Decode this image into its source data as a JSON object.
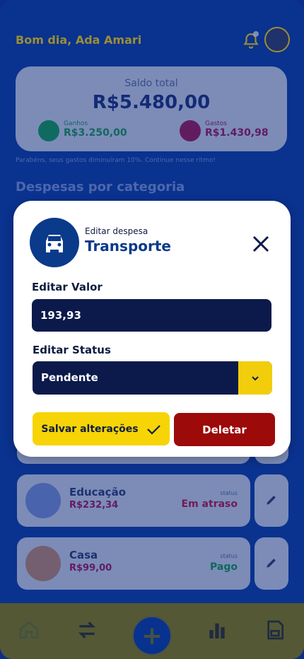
{
  "header": {
    "greeting": "Bom dia, Ada Amari"
  },
  "balance": {
    "label": "Saldo total",
    "value": "R$5.480,00",
    "income_label": "Ganhos",
    "income_value": "R$3.250,00",
    "expense_label": "Gastos",
    "expense_value": "R$1.430,98"
  },
  "tip": "Parabéns, seus gastos diminuíram 10%. Continue nesse ritmo!",
  "section_title": "Despesas por categoria",
  "categories": [
    {
      "name": "Educação",
      "amount": "R$232,34",
      "status_label": "status",
      "status": "Em atraso",
      "status_color": "#c2133f"
    },
    {
      "name": "Casa",
      "amount": "R$99,00",
      "status_label": "status",
      "status": "Pago",
      "status_color": "#169a49"
    }
  ],
  "modal": {
    "subtitle": "Editar despesa",
    "title": "Transporte",
    "value_label": "Editar Valor",
    "value": "193,93",
    "status_label": "Editar Status",
    "status_value": "Pendente",
    "save_label": "Salvar alterações",
    "delete_label": "Deletar"
  },
  "colors": {
    "primary": "#0a3a8a",
    "accent": "#f6d405",
    "danger": "#9c0a0a",
    "dark": "#0b1a4a"
  },
  "icons": [
    "bell-icon",
    "avatar",
    "car-icon",
    "close-icon",
    "chevron-down-icon",
    "check-icon",
    "pencil-icon",
    "home-icon",
    "transfer-icon",
    "plus-icon",
    "chart-icon",
    "save-icon"
  ]
}
